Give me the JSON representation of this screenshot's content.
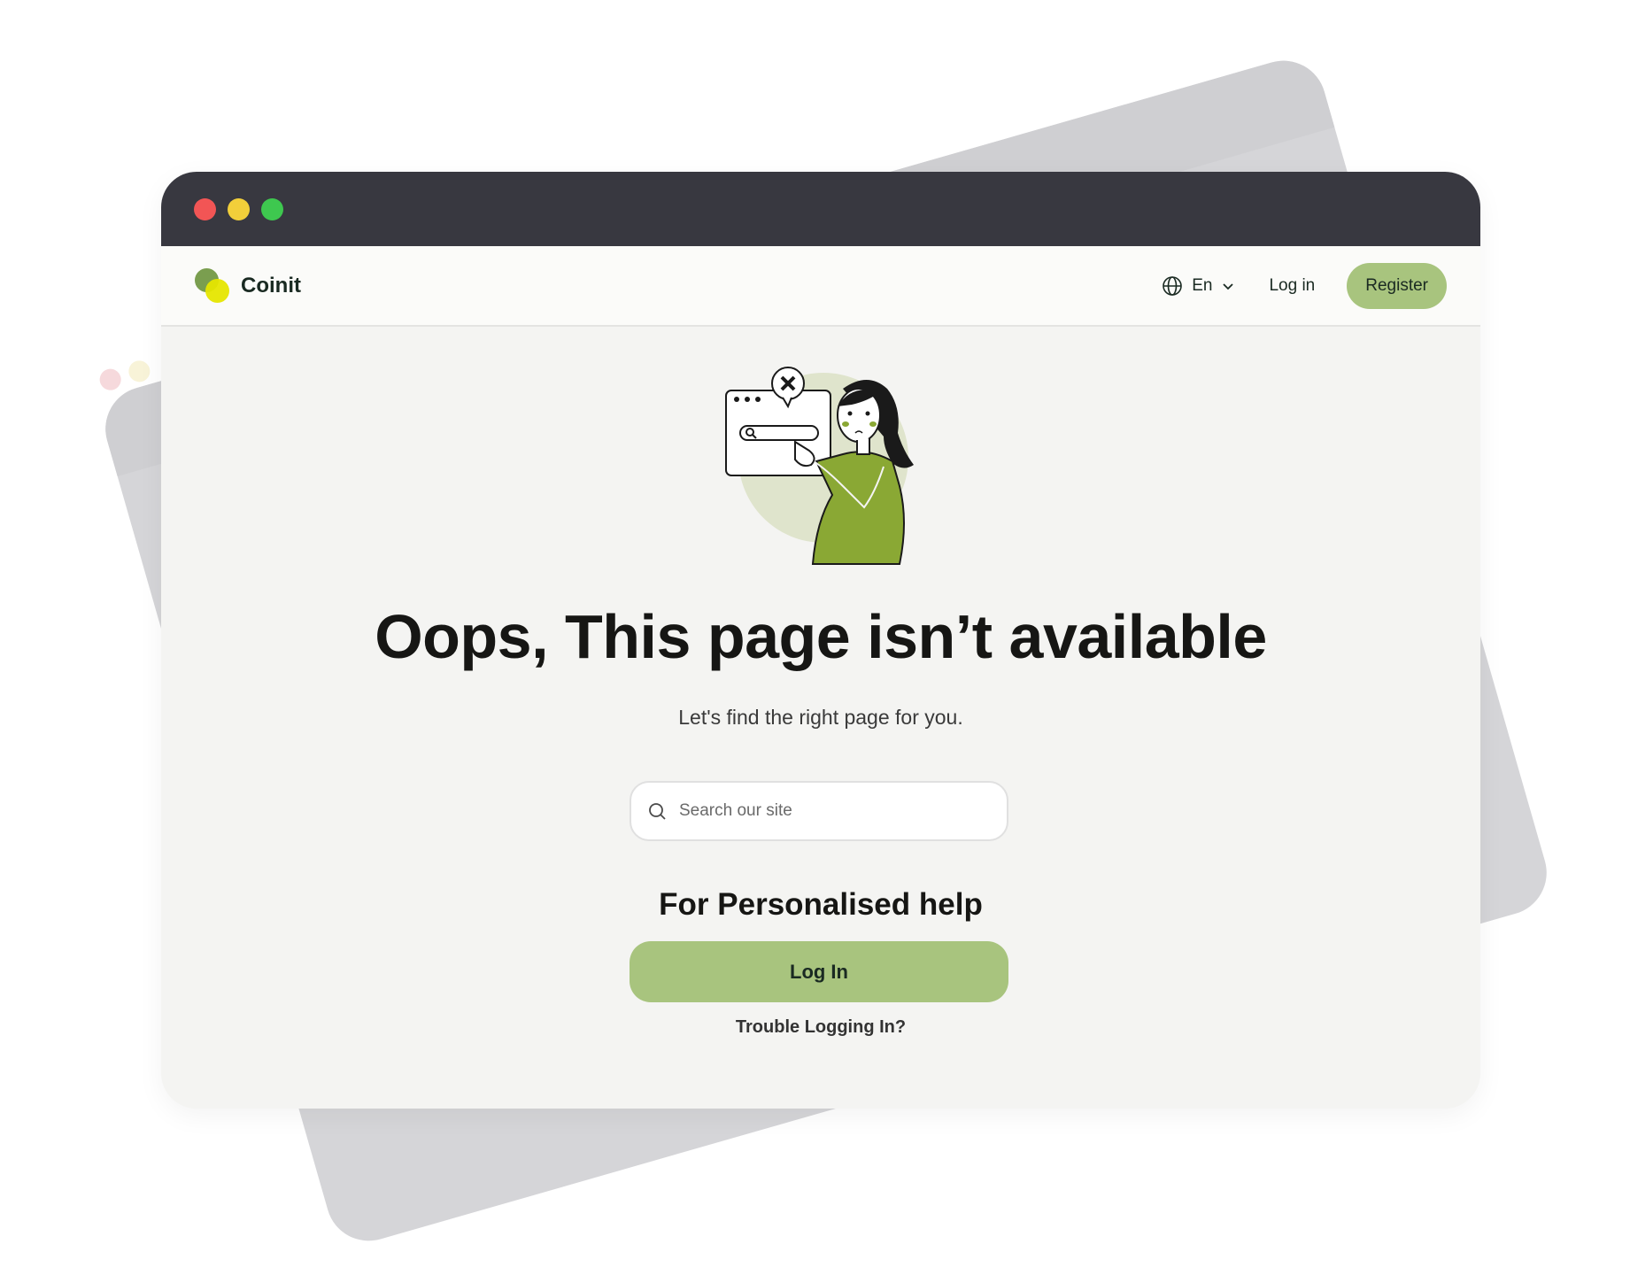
{
  "window": {
    "traffic_lights": [
      "#f25555",
      "#f2cf3a",
      "#3ec84f"
    ]
  },
  "header": {
    "brand": "Coinit",
    "language": "En",
    "login_label": "Log in",
    "register_label": "Register"
  },
  "main": {
    "headline": "Oops, This page isn’t available",
    "subheadline": "Let's find the right page for you.",
    "search_placeholder": "Search our site",
    "help_title": "For Personalised help",
    "login_button": "Log In",
    "trouble_link": "Trouble Logging In?"
  },
  "colors": {
    "accent": "#a8c47e",
    "titlebar": "#383840",
    "sweater": "#8aa834"
  }
}
